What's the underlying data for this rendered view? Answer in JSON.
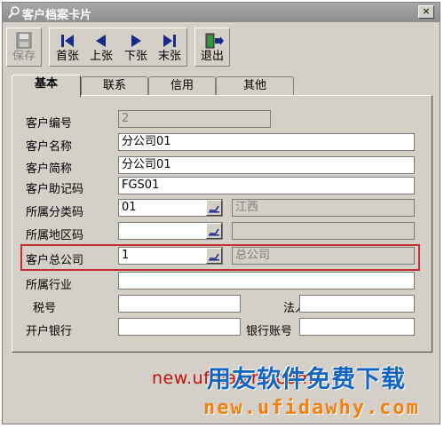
{
  "window": {
    "title": "客户档案卡片",
    "close_glyph": "×"
  },
  "toolbar": {
    "save": "保存",
    "first": "首张",
    "prev": "上张",
    "next": "下张",
    "last": "末张",
    "exit": "退出"
  },
  "tabs": [
    "基本",
    "联系",
    "信用",
    "其他"
  ],
  "form": {
    "customer_code": {
      "label": "客户编号",
      "value": "2"
    },
    "customer_name": {
      "label": "客户名称",
      "value": "分公司01"
    },
    "customer_short": {
      "label": "客户简称",
      "value": "分公司01"
    },
    "mnemonic": {
      "label": "客户助记码",
      "value": "FGS01"
    },
    "category": {
      "label": "所属分类码",
      "value": "01",
      "desc": "江西"
    },
    "region": {
      "label": "所属地区码",
      "value": "",
      "desc": ""
    },
    "head_company": {
      "label": "客户总公司",
      "value": "1",
      "desc": "总公司"
    },
    "industry": {
      "label": "所属行业",
      "value": ""
    },
    "tax_no": {
      "label": "税号",
      "value": ""
    },
    "legal_person": {
      "label": "法人",
      "value": ""
    },
    "bank": {
      "label": "开户银行",
      "value": ""
    },
    "bank_account": {
      "label": "银行账号",
      "value": ""
    }
  },
  "watermark": {
    "url_red": "new.ufidawhy.com",
    "big_text": "用友软件免费下载",
    "url_orange": "new.ufidawhy.com"
  },
  "colors": {
    "highlight": "#c03030",
    "watermark_blue": "#1565c0",
    "watermark_orange": "#f08010"
  }
}
